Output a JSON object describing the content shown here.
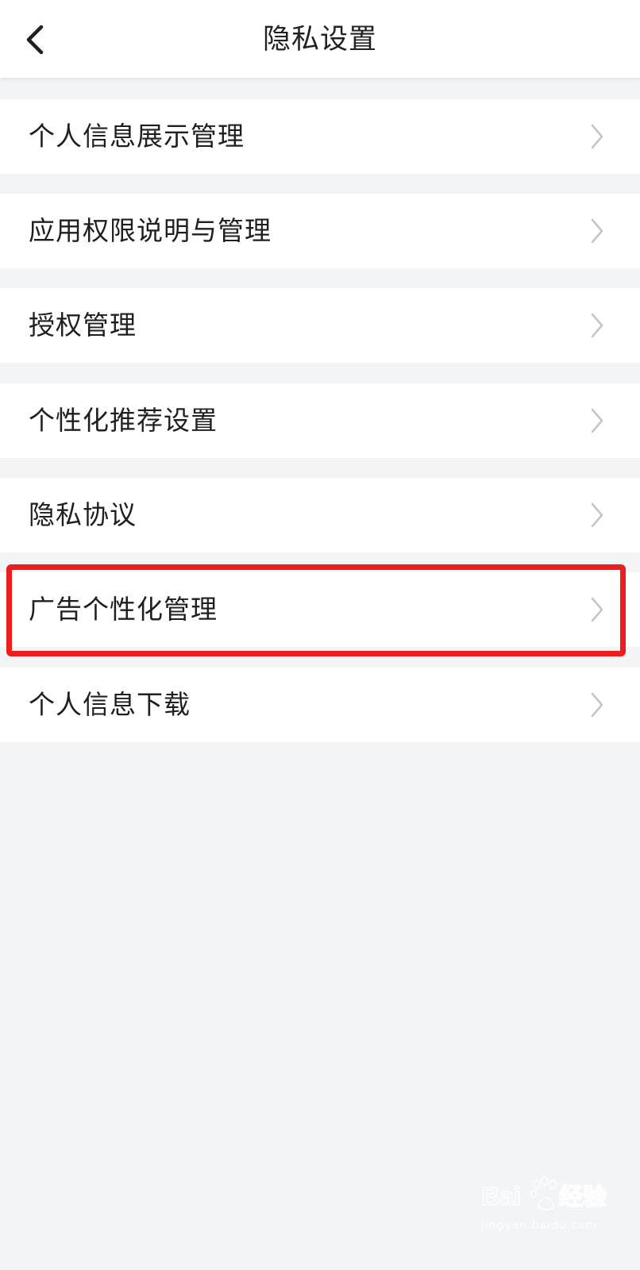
{
  "header": {
    "title": "隐私设置",
    "back_icon": "chevron-left-icon"
  },
  "menu": {
    "items": [
      {
        "label": "个人信息展示管理"
      },
      {
        "label": "应用权限说明与管理"
      },
      {
        "label": "授权管理"
      },
      {
        "label": "个性化推荐设置"
      },
      {
        "label": "隐私协议"
      },
      {
        "label": "广告个性化管理",
        "highlighted": true
      },
      {
        "label": "个人信息下载"
      }
    ],
    "row_icon": "chevron-right-icon"
  },
  "highlight": {
    "color": "#ee1c1c"
  },
  "watermark": {
    "logo_text": "Baidu 经验",
    "subtext": "jingyan.baidu.com"
  },
  "colors": {
    "background": "#f3f4f6",
    "row": "#ffffff",
    "text": "#1f1f1f",
    "chevron": "#c4c4c4"
  }
}
